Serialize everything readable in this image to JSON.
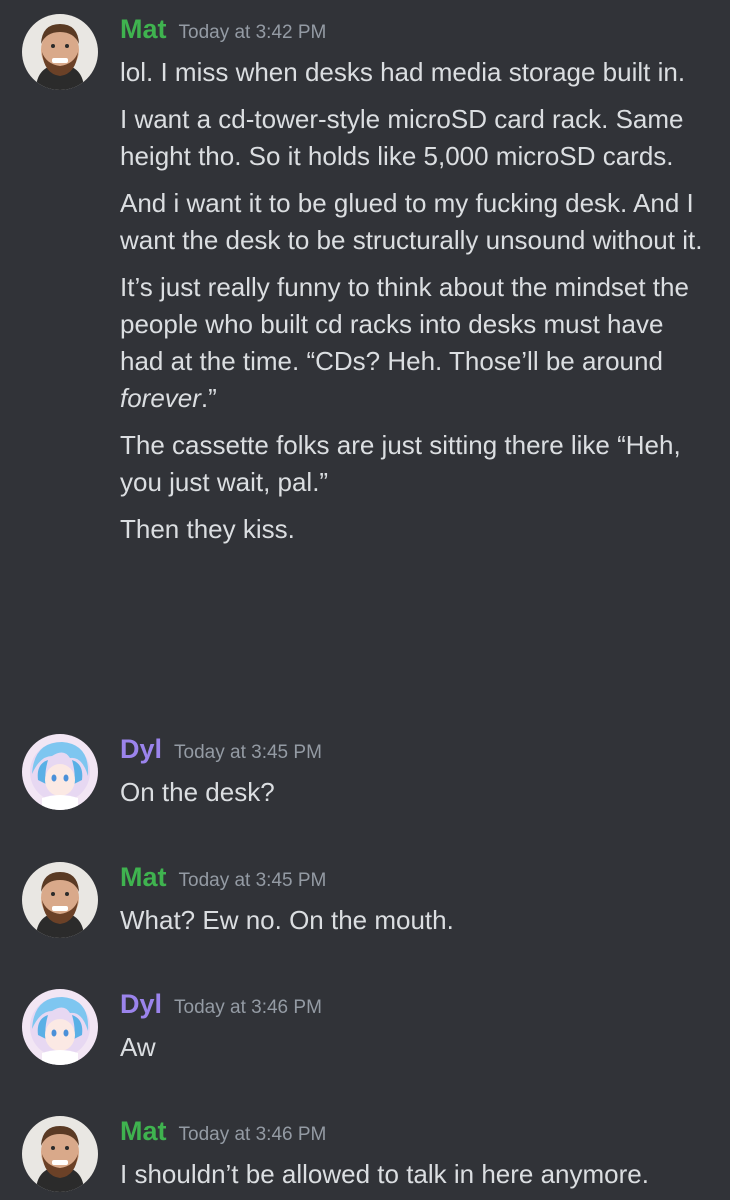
{
  "messages": [
    {
      "author": "Mat",
      "time": "Today at 3:42 PM",
      "lines": [
        "lol. I miss when desks had media storage built in.",
        "I want a cd-tower-style microSD card rack. Same height tho. So it holds like 5,000 microSD cards.",
        "And i want it to be glued to my fucking desk. And I want the desk to be structurally unsound without it.",
        {
          "before": "It’s just really funny to think about the mindset the people who built cd racks into desks must have had at the time. “CDs? Heh. Those’ll be around ",
          "emphasis": "forever",
          "after": ".”"
        },
        "The cassette folks are just sitting there like “Heh, you just wait, pal.”",
        "Then they kiss."
      ]
    },
    {
      "author": "Dyl",
      "time": "Today at 3:45 PM",
      "lines": [
        "On the desk?"
      ]
    },
    {
      "author": "Mat",
      "time": "Today at 3:45 PM",
      "lines": [
        "What? Ew no. On the mouth."
      ]
    },
    {
      "author": "Dyl",
      "time": "Today at 3:46 PM",
      "lines": [
        "Aw"
      ]
    },
    {
      "author": "Mat",
      "time": "Today at 3:46 PM",
      "lines": [
        "I shouldn’t be allowed to talk in here anymore."
      ]
    }
  ],
  "colors": {
    "background": "#313338",
    "text": "#dbdee1",
    "timestamp": "#949ba4",
    "mat_name": "#3fb34f",
    "dyl_name": "#9b84ec"
  }
}
